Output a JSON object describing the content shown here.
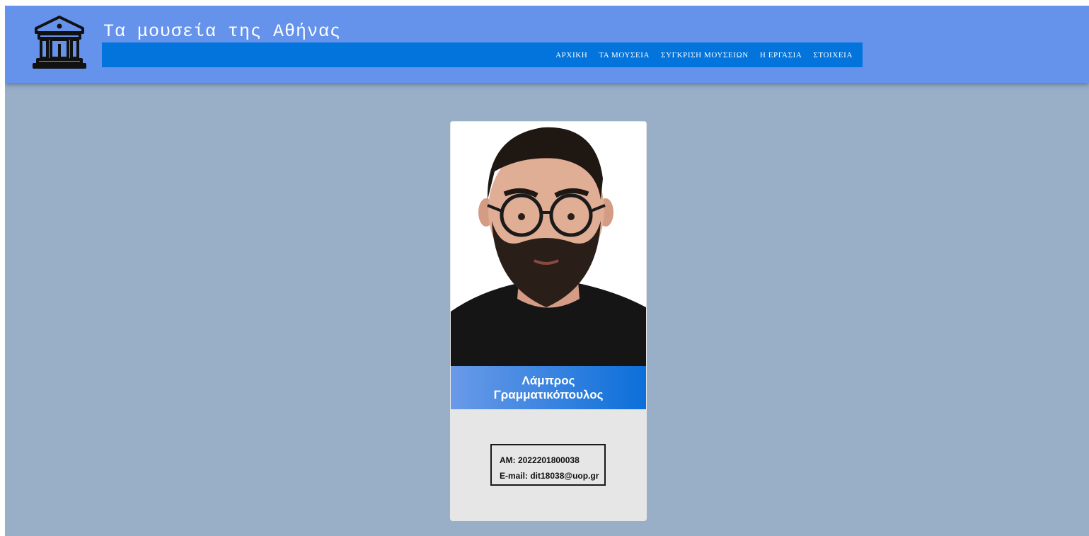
{
  "header": {
    "site_title": "Τα μουσεία της Αθήνας",
    "logo_icon": "museum-building-icon",
    "nav": [
      {
        "label": "ΑΡΧΙΚΗ"
      },
      {
        "label": "ΤΑ ΜΟΥΣΕΙΑ"
      },
      {
        "label": "ΣΥΓΚΡΙΣΗ ΜΟΥΣΕΙΩΝ"
      },
      {
        "label": "Η ΕΡΓΑΣΙΑ"
      },
      {
        "label": "ΣΤΟΙΧΕΙΑ"
      }
    ]
  },
  "card": {
    "name_first": "Λάμπρος",
    "name_last": "Γραμματικόπουλος",
    "am": "AM: 2022201800038",
    "email": "E-mail: dit18038@uop.gr"
  },
  "colors": {
    "header_bg": "#6593eb",
    "navbar_bg": "#0274dc",
    "page_bg": "#99afc8",
    "card_bg": "#e6e6e6"
  }
}
